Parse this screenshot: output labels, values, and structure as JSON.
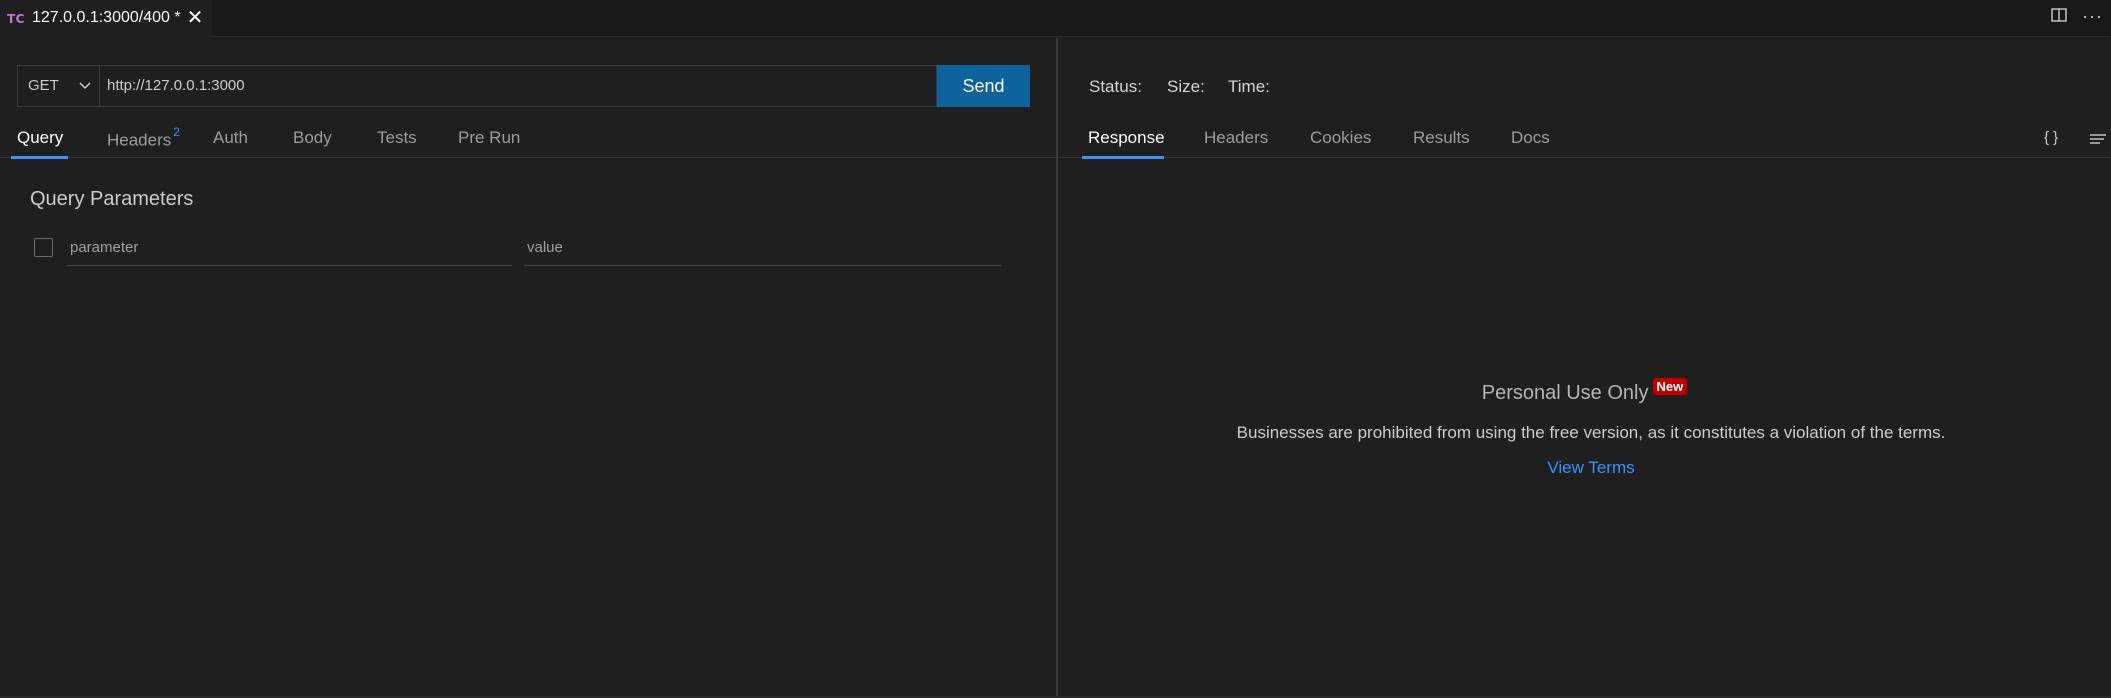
{
  "tab": {
    "badge": "TC",
    "title": "127.0.0.1:3000/400 *",
    "close": "✕"
  },
  "window_actions": {
    "split_icon": "split-editor-icon",
    "more_icon": "more-actions-icon",
    "more_label": "···"
  },
  "request": {
    "method": "GET",
    "url": "http://127.0.0.1:3000",
    "send_label": "Send",
    "tabs": [
      {
        "label": "Query",
        "active": true
      },
      {
        "label": "Headers",
        "count": "2"
      },
      {
        "label": "Auth"
      },
      {
        "label": "Body"
      },
      {
        "label": "Tests"
      },
      {
        "label": "Pre Run"
      }
    ],
    "query": {
      "title": "Query Parameters",
      "param_placeholder": "parameter",
      "value_placeholder": "value"
    }
  },
  "response": {
    "status_label": "Status:",
    "size_label": "Size:",
    "time_label": "Time:",
    "tabs": [
      {
        "label": "Response",
        "active": true
      },
      {
        "label": "Headers"
      },
      {
        "label": "Cookies"
      },
      {
        "label": "Results"
      },
      {
        "label": "Docs"
      }
    ],
    "format_icon_label": "{ }",
    "notice": {
      "title": "Personal Use Only",
      "badge": "New",
      "description": "Businesses are prohibited from using the free version, as it constitutes a violation of the terms.",
      "link": "View Terms"
    }
  },
  "colors": {
    "accent": "#3794ff",
    "send_button": "#0e639c",
    "badge_red": "#c00000",
    "background": "#1f1f1f"
  }
}
